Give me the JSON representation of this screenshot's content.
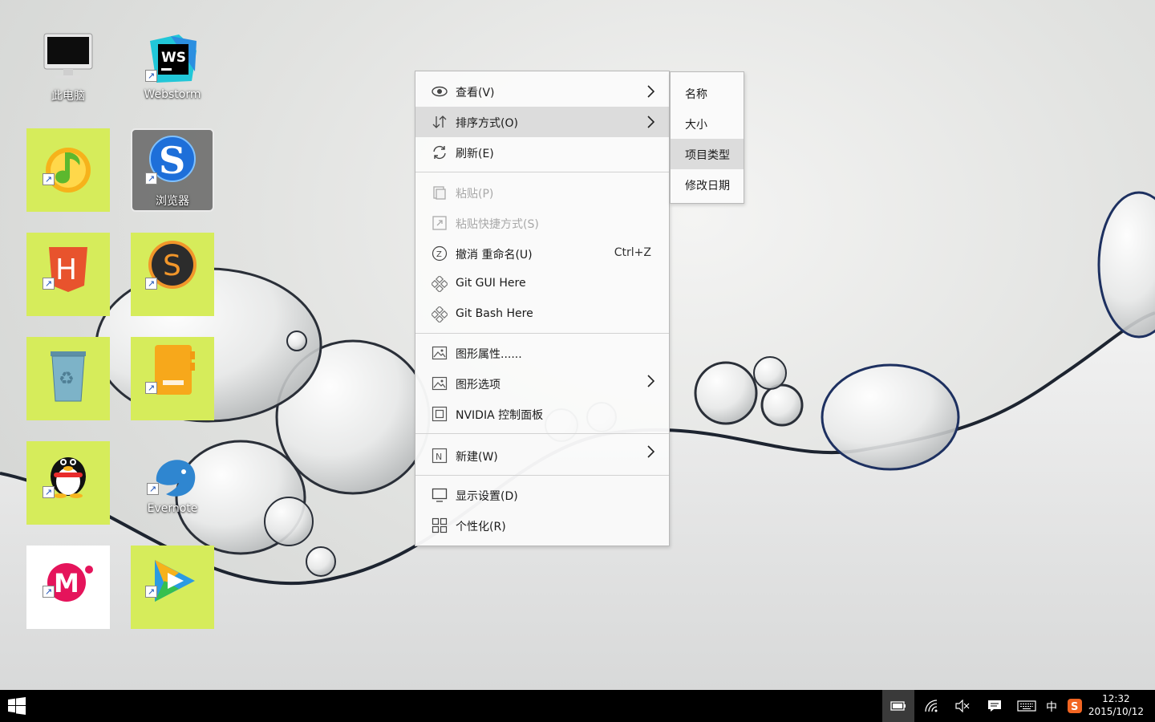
{
  "desktop": {
    "icons": [
      {
        "label": "此电脑"
      },
      {
        "label": "Webstorm"
      },
      {
        "label": ""
      },
      {
        "label": "浏览器"
      },
      {
        "label": ""
      },
      {
        "label": ""
      },
      {
        "label": ""
      },
      {
        "label": ""
      },
      {
        "label": ""
      },
      {
        "label": "Evernote"
      },
      {
        "label": ""
      },
      {
        "label": ""
      }
    ],
    "tile_color": "#d6ec5b"
  },
  "context_menu": {
    "items": [
      {
        "label": "查看(V)",
        "icon": "eye-icon",
        "submenu": true
      },
      {
        "label": "排序方式(O)",
        "icon": "sort-icon",
        "submenu": true,
        "highlighted": true
      },
      {
        "label": "刷新(E)",
        "icon": "refresh-icon"
      },
      {
        "label": "粘贴(P)",
        "icon": "paste-icon",
        "disabled": true
      },
      {
        "label": "粘贴快捷方式(S)",
        "icon": "paste-shortcut-icon",
        "disabled": true
      },
      {
        "label": "撤消 重命名(U)",
        "icon": "undo-icon",
        "shortcut": "Ctrl+Z"
      },
      {
        "label": "Git GUI Here",
        "icon": "git-icon"
      },
      {
        "label": "Git Bash Here",
        "icon": "git-icon"
      },
      {
        "label": "图形属性......",
        "icon": "image-icon"
      },
      {
        "label": "图形选项",
        "icon": "image-icon",
        "submenu": true
      },
      {
        "label": "NVIDIA 控制面板",
        "icon": "nvidia-icon"
      },
      {
        "label": "新建(W)",
        "icon": "new-icon",
        "submenu": true
      },
      {
        "label": "显示设置(D)",
        "icon": "monitor-icon"
      },
      {
        "label": "个性化(R)",
        "icon": "personalize-icon"
      }
    ]
  },
  "sort_submenu": {
    "items": [
      {
        "label": "名称"
      },
      {
        "label": "大小"
      },
      {
        "label": "项目类型",
        "highlighted": true
      },
      {
        "label": "修改日期"
      }
    ]
  },
  "taskbar": {
    "start_icon": "windows-logo-icon",
    "tray": {
      "ime": "中",
      "time": "12:32",
      "date": "2015/10/12"
    }
  }
}
